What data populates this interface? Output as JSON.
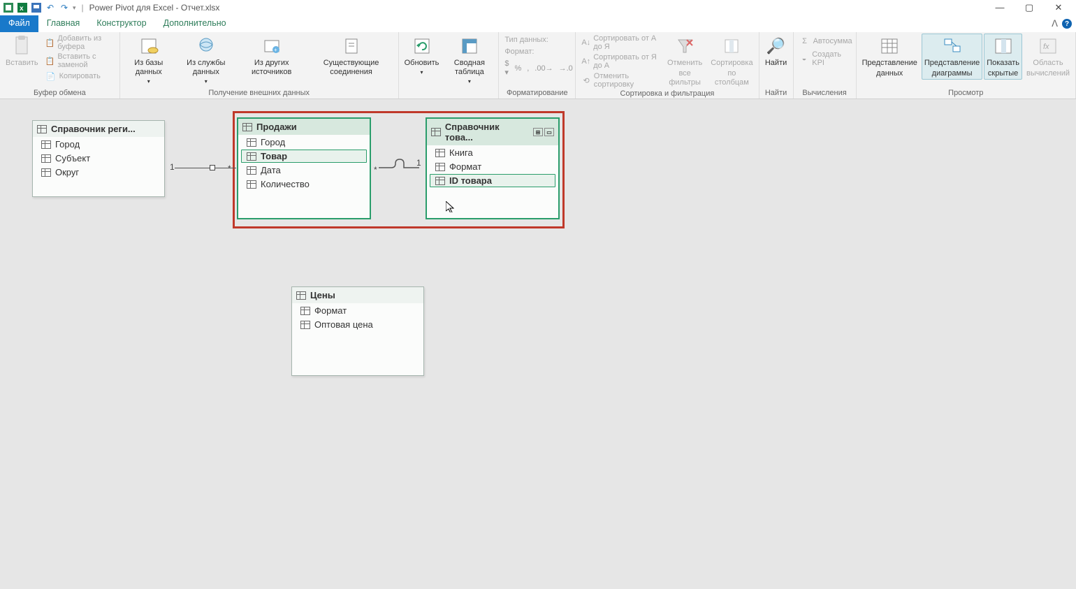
{
  "titlebar": {
    "title": "Power Pivot для Excel - Отчет.xlsx"
  },
  "menu": {
    "file": "Файл",
    "home": "Главная",
    "design": "Конструктор",
    "advanced": "Дополнительно"
  },
  "ribbon": {
    "clipboard": {
      "paste": "Вставить",
      "add_buffer": "Добавить из буфера",
      "paste_replace": "Вставить с заменой",
      "copy": "Копировать",
      "group_label": "Буфер обмена"
    },
    "external": {
      "from_db": "Из базы данных",
      "from_service": "Из службы данных",
      "from_other": "Из других источников",
      "existing": "Существующие соединения",
      "group_label": "Получение внешних данных"
    },
    "refresh": "Обновить",
    "pivot": "Сводная таблица",
    "formatting": {
      "data_type": "Тип данных:",
      "format": "Формат:",
      "group_label": "Форматирование"
    },
    "sort_filter": {
      "az": "Сортировать от А до Я",
      "za": "Сортировать от Я до А",
      "clear": "Отменить сортировку",
      "clear_filters1": "Отменить",
      "clear_filters2": "все фильтры",
      "by_col1": "Сортировка",
      "by_col2": "по столбцам",
      "group_label": "Сортировка и фильтрация"
    },
    "find": {
      "label": "Найти",
      "group_label": "Найти"
    },
    "calc": {
      "autosum": "Автосумма",
      "kpi": "Создать KPI",
      "group_label": "Вычисления"
    },
    "view": {
      "data_view1": "Представление",
      "data_view2": "данных",
      "diagram_view1": "Представление",
      "diagram_view2": "диаграммы",
      "show_hidden1": "Показать",
      "show_hidden2": "скрытые",
      "calc_area1": "Область",
      "calc_area2": "вычислений",
      "group_label": "Просмотр"
    }
  },
  "tables": {
    "regions": {
      "name": "Справочник реги...",
      "fields": {
        "city": "Город",
        "subject": "Субъект",
        "district": "Округ"
      }
    },
    "sales": {
      "name": "Продажи",
      "fields": {
        "city": "Город",
        "product": "Товар",
        "date": "Дата",
        "qty": "Количество"
      }
    },
    "products": {
      "name": "Справочник това...",
      "fields": {
        "book": "Книга",
        "format": "Формат",
        "id": "ID товара"
      }
    },
    "prices": {
      "name": "Цены",
      "fields": {
        "format": "Формат",
        "whole": "Оптовая цена"
      }
    }
  },
  "relation": {
    "one_a": "1",
    "one_b": "1",
    "many": "*"
  }
}
